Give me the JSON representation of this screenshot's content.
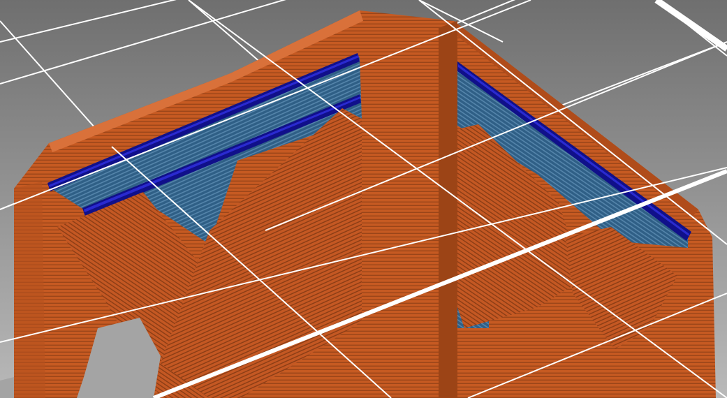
{
  "viewport": {
    "background_top": "#6f6f6f",
    "background_bottom": "#b9b9b9",
    "grid_color": "#ffffff"
  },
  "model": {
    "perimeter_color": "#c65a22",
    "perimeter_shadow": "#7a3412",
    "perimeter_highlight": "#d9713a",
    "infill_color": "#2f5f86",
    "infill_stripe": "#5f8fb4",
    "support_color": "#10108a",
    "support_highlight": "#2a2ad0",
    "layer_line_color": "#8a3d15"
  }
}
